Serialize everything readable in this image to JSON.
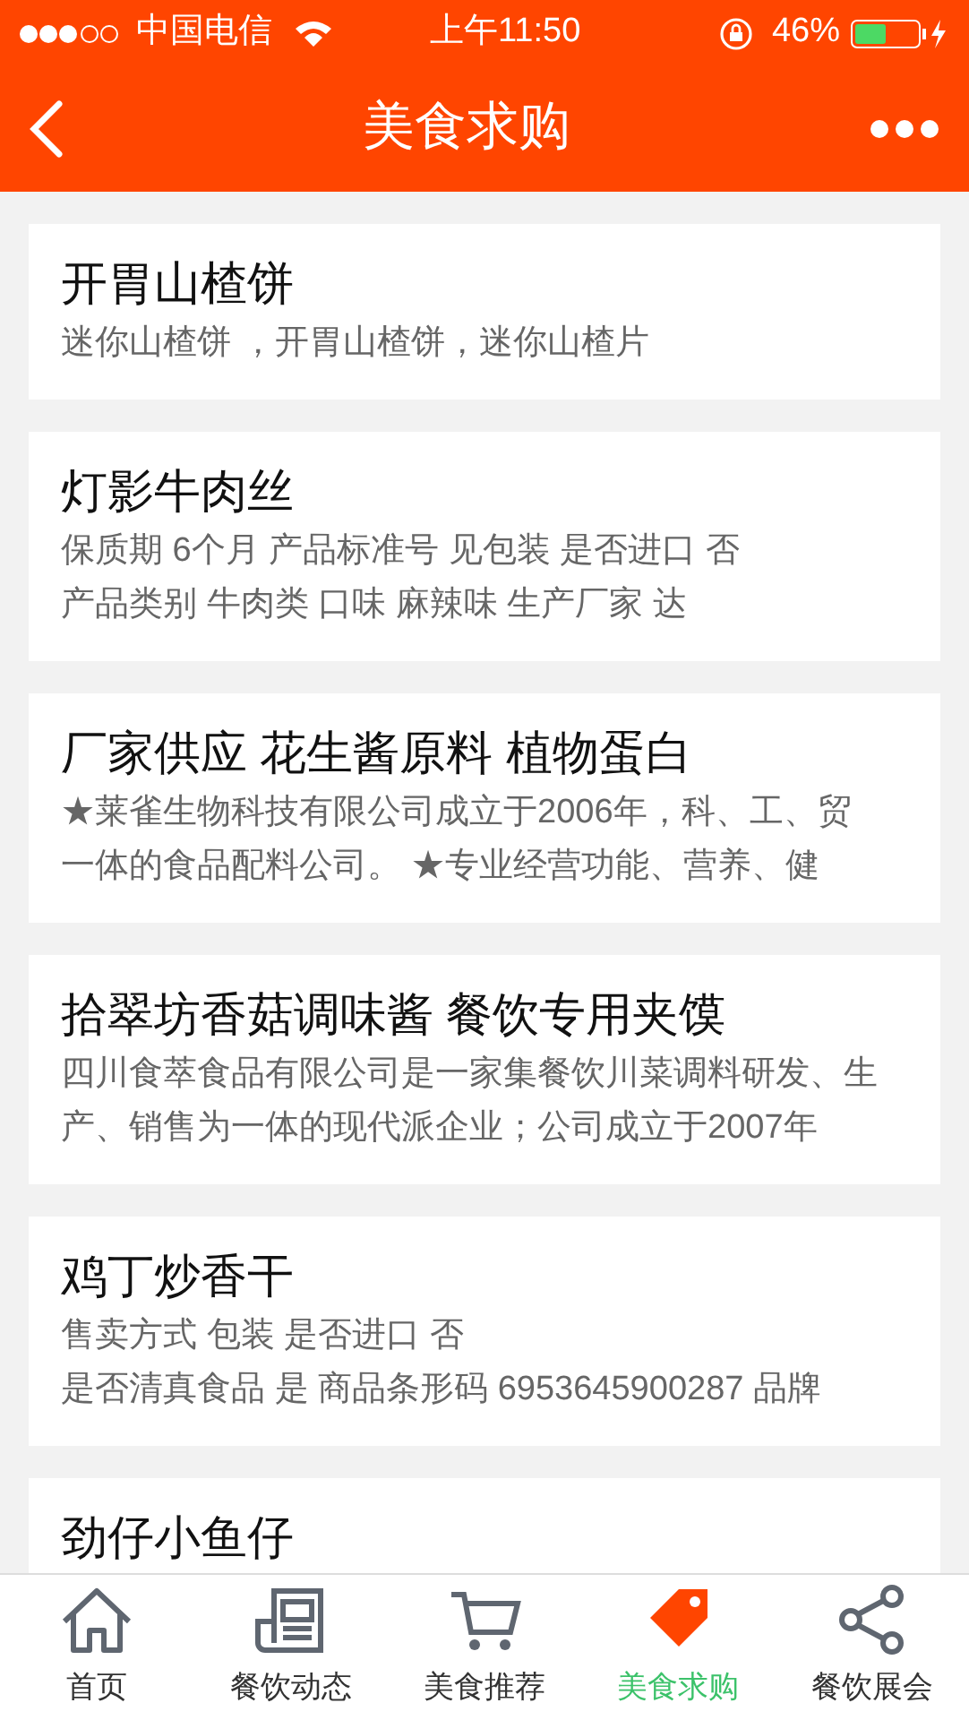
{
  "status_bar": {
    "carrier": "中国电信",
    "time": "上午11:50",
    "battery": "46%"
  },
  "header": {
    "title": "美食求购"
  },
  "items": [
    {
      "title": "开胃山楂饼",
      "lines": [
        "迷你山楂饼 ，开胃山楂饼，迷你山楂片"
      ]
    },
    {
      "title": "灯影牛肉丝",
      "lines": [
        "保质期 6个月 产品标准号 见包装 是否进口 否",
        "产品类别 牛肉类 口味 麻辣味 生产厂家 达"
      ]
    },
    {
      "title": "厂家供应 花生酱原料 植物蛋白",
      "lines": [
        "★莱雀生物科技有限公司成立于2006年，科、工、贸",
        "一体的食品配料公司。 ★专业经营功能、营养、健"
      ]
    },
    {
      "title": "拾翠坊香菇调味酱 餐饮专用夹馍",
      "lines": [
        "四川食萃食品有限公司是一家集餐饮川菜调料研发、生",
        "产、销售为一体的现代派企业；公司成立于2007年"
      ]
    },
    {
      "title": "鸡丁炒香干",
      "lines": [
        "售卖方式 包装 是否进口 否",
        "是否清真食品 是 商品条形码 6953645900287 品牌"
      ]
    },
    {
      "title": "劲仔小鱼仔"
    }
  ],
  "tabs": [
    {
      "kind": "home",
      "label": "首页",
      "selected": false
    },
    {
      "kind": "news",
      "label": "餐饮动态",
      "selected": false
    },
    {
      "kind": "cart",
      "label": "美食推荐",
      "selected": false
    },
    {
      "kind": "tag",
      "label": "美食求购",
      "selected": true
    },
    {
      "kind": "share",
      "label": "餐饮展会",
      "selected": false
    }
  ]
}
